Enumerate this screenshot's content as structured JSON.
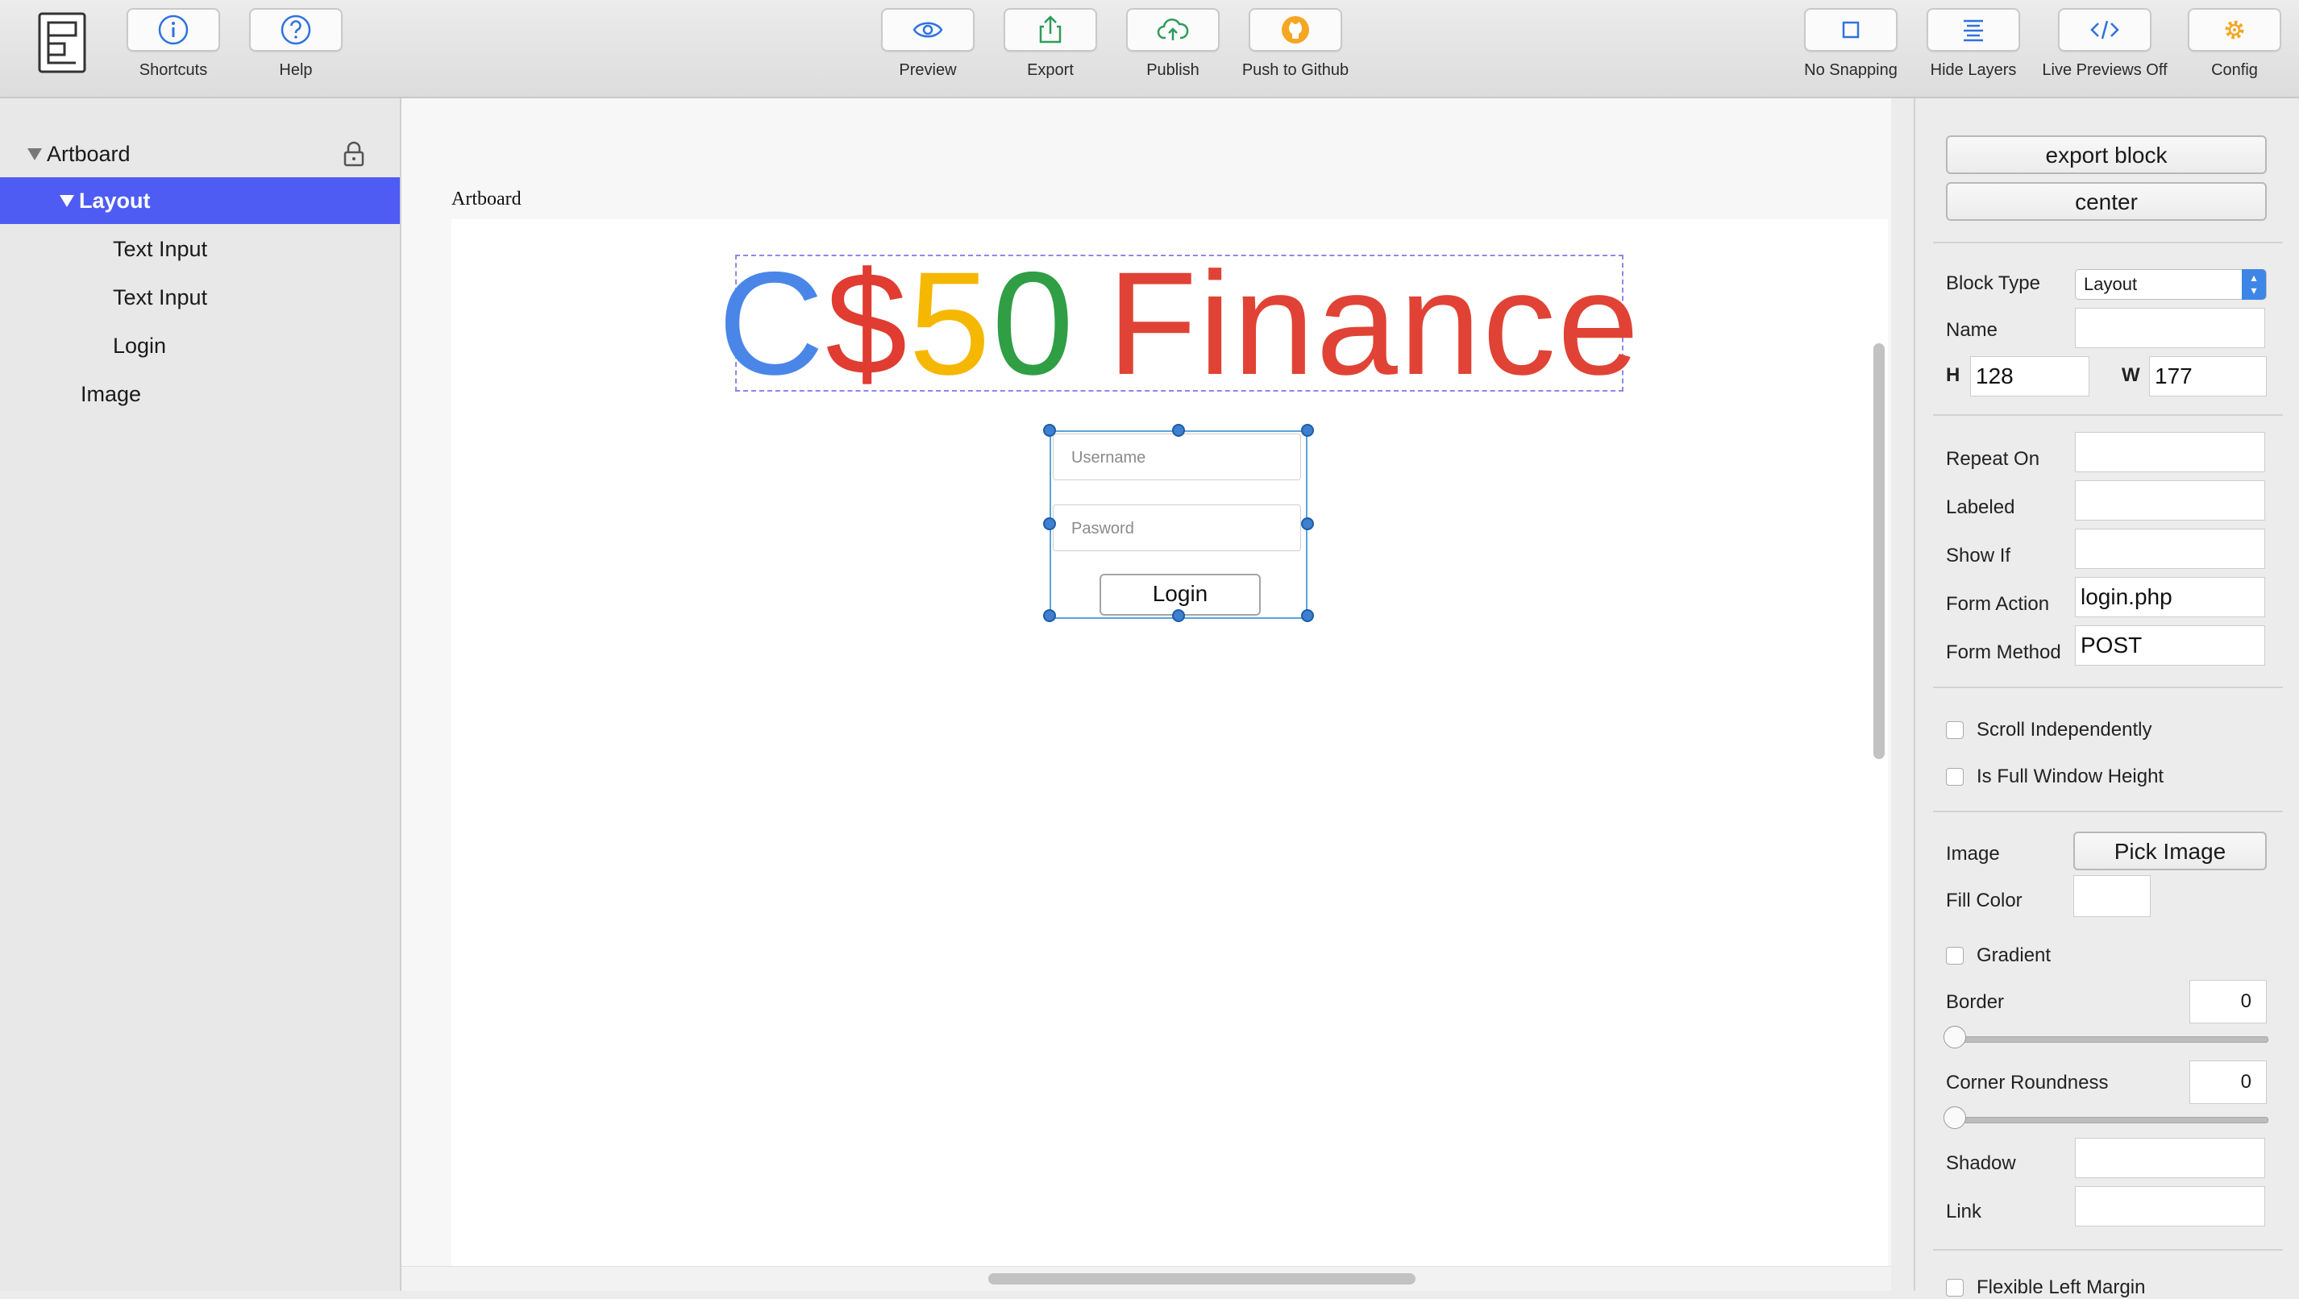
{
  "toolbar": {
    "shortcuts": "Shortcuts",
    "help": "Help",
    "preview": "Preview",
    "export": "Export",
    "publish": "Publish",
    "push": "Push to Github",
    "snapping": "No Snapping",
    "hide_layers": "Hide Layers",
    "live_previews": "Live Previews Off",
    "config": "Config"
  },
  "layers": {
    "root": "Artboard",
    "items": [
      {
        "label": "Layout"
      },
      {
        "label": "Text Input"
      },
      {
        "label": "Text Input"
      },
      {
        "label": "Login"
      },
      {
        "label": "Image"
      }
    ]
  },
  "canvas": {
    "artboard_label": "Artboard",
    "logo": {
      "c": "C",
      "dollar": "$",
      "five": "5",
      "zero": "0",
      "finance": "Finance",
      "colors": {
        "c": "#4a86e8",
        "dollar": "#e03c31",
        "five": "#f5b700",
        "zero": "#2f9e44",
        "finance": "#e04335"
      }
    },
    "username_placeholder": "Username",
    "password_placeholder": "Pasword",
    "login_button": "Login",
    "selection_color": "#5aa4da"
  },
  "inspector": {
    "export_block": "export block",
    "center": "center",
    "block_type_label": "Block Type",
    "block_type_value": "Layout",
    "name_label": "Name",
    "name_value": "",
    "h_label": "H",
    "h_value": "128",
    "w_label": "W",
    "w_value": "177",
    "repeat_on": "Repeat On",
    "labeled": "Labeled",
    "show_if": "Show If",
    "form_action_label": "Form Action",
    "form_action_value": "login.php",
    "form_method_label": "Form Method",
    "form_method_value": "POST",
    "scroll_independently": "Scroll Independently",
    "full_window_height": "Is Full Window Height",
    "image_label": "Image",
    "pick_image": "Pick Image",
    "fill_color": "Fill Color",
    "gradient": "Gradient",
    "border_label": "Border",
    "border_value": "0",
    "corner_label": "Corner Roundness",
    "corner_value": "0",
    "shadow_label": "Shadow",
    "link_label": "Link",
    "flexible_left_margin": "Flexible Left Margin"
  }
}
